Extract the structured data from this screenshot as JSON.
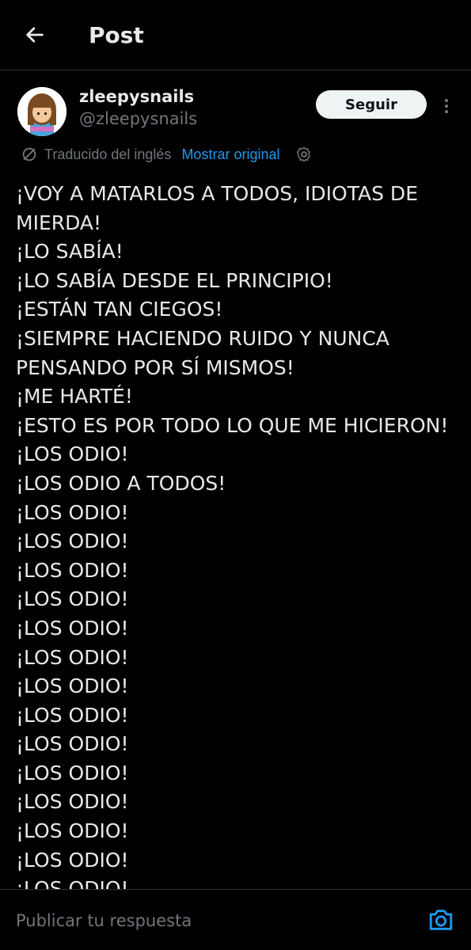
{
  "header": {
    "title": "Post",
    "back_icon": "arrow-left-icon"
  },
  "author": {
    "display_name": "zleepysnails",
    "handle": "@zleepysnails",
    "follow_label": "Seguir",
    "more_icon": "more-vertical-icon"
  },
  "translation": {
    "label": "Traducido del inglés",
    "show_original": "Mostrar original",
    "icon": "translate-icon",
    "settings_icon": "gear-icon"
  },
  "post_lines": [
    "¡VOY A MATARLOS A TODOS, IDIOTAS DE MIERDA!",
    "¡LO SABÍA!",
    "¡LO SABÍA DESDE EL PRINCIPIO!",
    "¡ESTÁN TAN CIEGOS!",
    "¡SIEMPRE HACIENDO RUIDO Y NUNCA PENSANDO POR SÍ MISMOS!",
    "¡ME HARTÉ!",
    "¡ESTO ES POR TODO LO QUE ME HICIERON!",
    "¡LOS ODIO!",
    "¡LOS ODIO A TODOS!",
    "¡LOS ODIO!",
    "¡LOS ODIO!",
    "¡LOS ODIO!",
    "¡LOS ODIO!",
    "¡LOS ODIO!",
    "¡LOS ODIO!",
    "¡LOS ODIO!",
    "¡LOS ODIO!",
    "¡LOS ODIO!",
    "¡LOS ODIO!",
    "¡LOS ODIO!",
    "¡LOS ODIO!",
    "¡LOS ODIO!",
    "¡LOS ODIO!"
  ],
  "reply": {
    "placeholder": "Publicar tu respuesta",
    "camera_icon": "camera-icon"
  },
  "colors": {
    "background": "#000000",
    "text": "#e7e9ea",
    "secondary": "#71767b",
    "accent": "#1d9bf0",
    "divider": "#2f3336"
  }
}
